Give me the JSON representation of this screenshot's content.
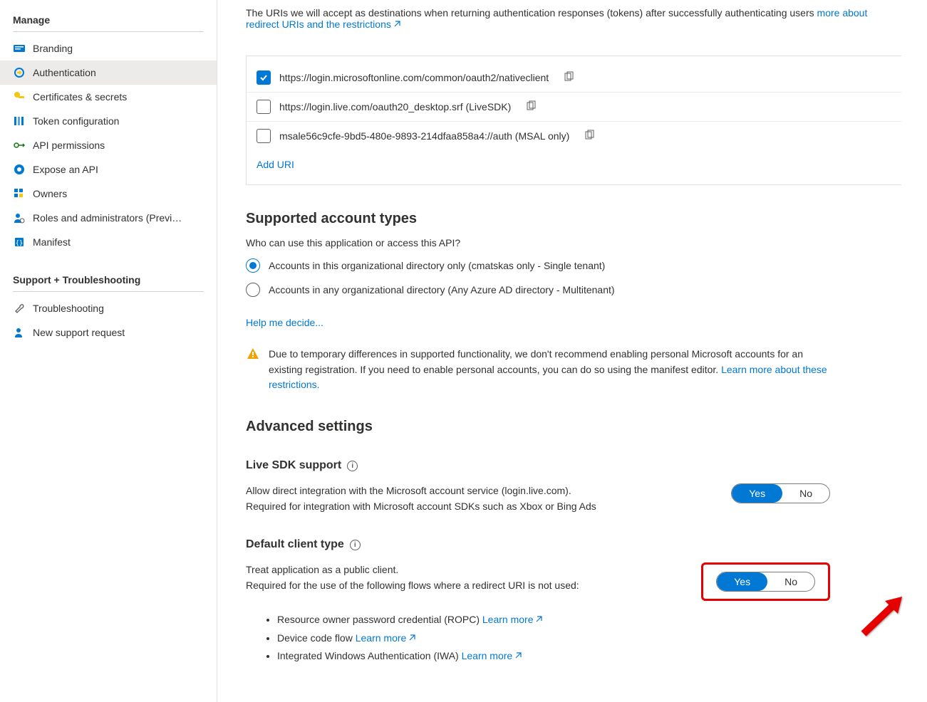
{
  "sidebar": {
    "sections": [
      {
        "label": "Manage",
        "items": [
          {
            "label": "Branding"
          },
          {
            "label": "Authentication",
            "active": true
          },
          {
            "label": "Certificates & secrets"
          },
          {
            "label": "Token configuration"
          },
          {
            "label": "API permissions"
          },
          {
            "label": "Expose an API"
          },
          {
            "label": "Owners"
          },
          {
            "label": "Roles and administrators (Previ…"
          },
          {
            "label": "Manifest"
          }
        ]
      },
      {
        "label": "Support + Troubleshooting",
        "items": [
          {
            "label": "Troubleshooting"
          },
          {
            "label": "New support request"
          }
        ]
      }
    ]
  },
  "intro": {
    "text_prefix": "The URIs we will accept as destinations when returning authentication responses (tokens) after successfully authenticating users",
    "link_text": "more about redirect URIs and the restrictions"
  },
  "uris": [
    {
      "checked": true,
      "text": "https://login.microsoftonline.com/common/oauth2/nativeclient"
    },
    {
      "checked": false,
      "text": "https://login.live.com/oauth20_desktop.srf (LiveSDK)"
    },
    {
      "checked": false,
      "text": "msale56c9cfe-9bd5-480e-9893-214dfaa858a4://auth (MSAL only)"
    }
  ],
  "add_uri_label": "Add URI",
  "supported_account_types": {
    "heading": "Supported account types",
    "question": "Who can use this application or access this API?",
    "options": [
      {
        "label": "Accounts in this organizational directory only (cmatskas only - Single tenant)",
        "selected": true
      },
      {
        "label": "Accounts in any organizational directory (Any Azure AD directory - Multitenant)",
        "selected": false
      }
    ],
    "help_link": "Help me decide...",
    "warning_text": "Due to temporary differences in supported functionality, we don't recommend enabling personal Microsoft accounts for an existing registration. If you need to enable personal accounts, you can do so using the manifest editor. ",
    "warning_link": "Learn more about these restrictions."
  },
  "advanced": {
    "heading": "Advanced settings",
    "live_sdk": {
      "title": "Live SDK support",
      "desc_line1": "Allow direct integration with the Microsoft account service (login.live.com).",
      "desc_line2": "Required for integration with Microsoft account SDKs such as Xbox or Bing Ads",
      "yes": "Yes",
      "no": "No"
    },
    "default_client": {
      "title": "Default client type",
      "desc_line1": "Treat application as a public client.",
      "desc_line2": "Required for the use of the following flows where a redirect URI is not used:",
      "yes": "Yes",
      "no": "No",
      "flows": [
        {
          "text": "Resource owner password credential (ROPC) ",
          "link": "Learn more"
        },
        {
          "text": "Device code flow ",
          "link": "Learn more"
        },
        {
          "text": "Integrated Windows Authentication (IWA) ",
          "link": "Learn more"
        }
      ]
    }
  }
}
